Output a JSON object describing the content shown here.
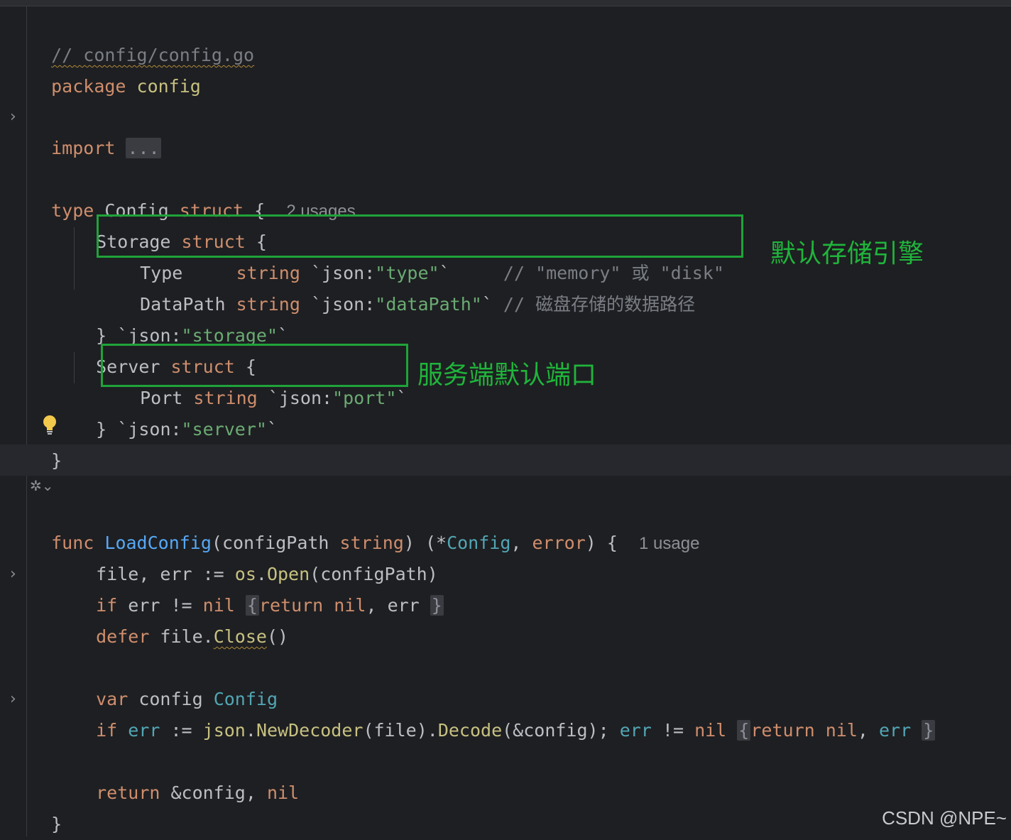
{
  "editor": {
    "file_comment": "// config/config.go",
    "lines": {
      "package_kw": "package",
      "package_name": "config",
      "import_kw": "import",
      "import_fold": "...",
      "type_kw": "type",
      "config_name": "Config",
      "struct_kw": "struct",
      "open_brace": "{",
      "config_usages": "2 usages",
      "storage_name": "Storage",
      "type_field": "Type",
      "string_kw": "string",
      "type_tag_open": "`json:",
      "type_tag_val": "\"type\"",
      "tag_close": "`",
      "type_comment": "// \"memory\" 或 \"disk\"",
      "datapath_field": "DataPath",
      "datapath_tag_val": "\"dataPath\"",
      "datapath_comment": "// 磁盘存储的数据路径",
      "close_brace": "}",
      "storage_tag_open": "`json:",
      "storage_tag_val": "\"storage\"",
      "server_name": "Server",
      "port_field": "Port",
      "port_tag_val": "\"port\"",
      "server_tag_val": "\"server\"",
      "func_kw": "func",
      "loadconfig_name": "LoadConfig",
      "configpath_param": "(configPath ",
      "ret_open": ") (*",
      "config_type": "Config",
      "comma": ", ",
      "error_kw": "error",
      "ret_close": ") {",
      "loadconfig_usages": "1 usage",
      "file_err_assign": "file, err := ",
      "os_pkg": "os",
      "dot": ".",
      "open_call": "Open",
      "open_args": "(configPath)",
      "if_kw": "if",
      "err_neq": " err != ",
      "nil_kw": "nil",
      "return_kw": "return",
      "err_word": "err",
      "defer_kw": "defer",
      "file_dot": " file.",
      "close_call": "Close",
      "close_parens": "()",
      "var_kw": "var",
      "config_var": " config ",
      "err_var": "err",
      "assign_op": " := ",
      "json_pkg": "json",
      "newdecoder_call": "NewDecoder",
      "file_arg": "(file).",
      "decode_call": "Decode",
      "decode_args": "(&config); ",
      "neq_op": " != ",
      "ret_config": " &config, ",
      "fold_open": "{",
      "fold_close": "}"
    }
  },
  "annotations": {
    "storage_engine_note": "默认存储引擎",
    "server_port_note": "服务端默认端口"
  },
  "watermark": "CSDN @NPE~",
  "colors": {
    "background": "#1e1f22",
    "keyword": "#cf8e6d",
    "string": "#6aab73",
    "comment": "#7a7e85",
    "function": "#56a8f5",
    "annotation": "#1fa33a"
  }
}
